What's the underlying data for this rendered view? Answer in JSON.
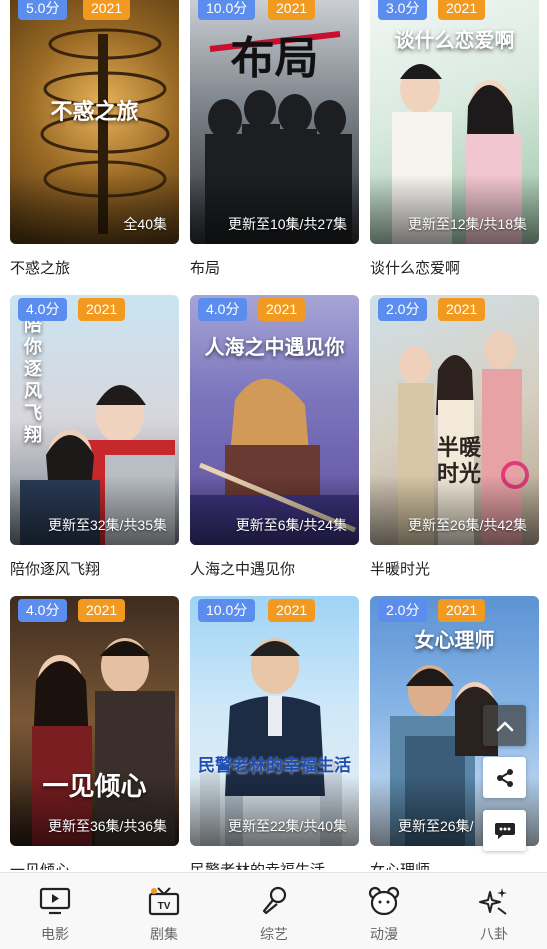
{
  "cards": [
    {
      "score": "5.0分",
      "year": "2021",
      "episodes": "全40集",
      "title": "不惑之旅",
      "poster_text": "不惑之旅"
    },
    {
      "score": "10.0分",
      "year": "2021",
      "episodes": "更新至10集/共27集",
      "title": "布局",
      "poster_text": "布局"
    },
    {
      "score": "3.0分",
      "year": "2021",
      "episodes": "更新至12集/共18集",
      "title": "谈什么恋爱啊",
      "poster_text": "谈什么恋爱啊"
    },
    {
      "score": "4.0分",
      "year": "2021",
      "episodes": "更新至32集/共35集",
      "title": "陪你逐风飞翔",
      "poster_text": "陪你逐风飞翔"
    },
    {
      "score": "4.0分",
      "year": "2021",
      "episodes": "更新至6集/共24集",
      "title": "人海之中遇见你",
      "poster_text": "人海之中遇见你"
    },
    {
      "score": "2.0分",
      "year": "2021",
      "episodes": "更新至26集/共42集",
      "title": "半暖时光",
      "poster_text": "半暖时光"
    },
    {
      "score": "4.0分",
      "year": "2021",
      "episodes": "更新至36集/共36集",
      "title": "一见倾心",
      "poster_text": "一见倾心"
    },
    {
      "score": "10.0分",
      "year": "2021",
      "episodes": "更新至22集/共40集",
      "title": "民警老林的幸福生活",
      "poster_text": "民警老林的幸福生活"
    },
    {
      "score": "2.0分",
      "year": "2021",
      "episodes": "更新至26集/",
      "title": "女心理师",
      "poster_text": "女心理师"
    }
  ],
  "tabs": [
    {
      "label": "电影",
      "icon": "movie-screen-icon"
    },
    {
      "label": "剧集",
      "icon": "tv-icon"
    },
    {
      "label": "综艺",
      "icon": "microphone-icon"
    },
    {
      "label": "动漫",
      "icon": "bear-head-icon"
    },
    {
      "label": "八卦",
      "icon": "sparkle-icon"
    }
  ],
  "colors": {
    "score_badge": "#5b8def",
    "year_badge": "#f29a1f",
    "tab_text": "#666666",
    "tabbar_bg": "#f8f8f8"
  }
}
